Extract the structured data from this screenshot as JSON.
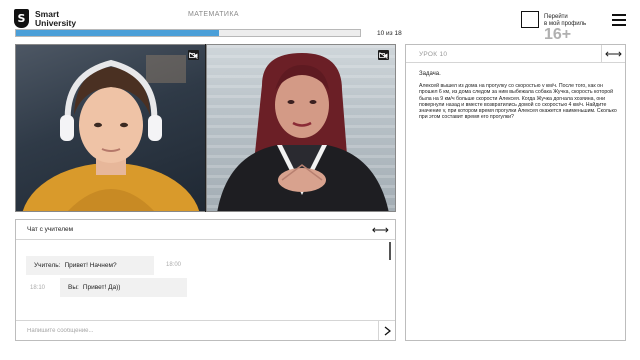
{
  "header": {
    "logo_glyph": "S",
    "logo_line1": "Smart",
    "logo_line2": "University",
    "subject": "МАТЕМАТИКА",
    "progress_fraction": 0.59,
    "progress_text": "10 из 18",
    "profile_line1": "Перейти",
    "profile_line2": "в мой профиль",
    "age_badge": "16+"
  },
  "videos": {
    "student_cam_icon": "camera-off-icon",
    "teacher_cam_icon": "camera-off-icon"
  },
  "chat": {
    "title": "Чат с учителем",
    "expand_glyph": "⟷",
    "messages": [
      {
        "sender": "Учитель:",
        "text": "Привет! Начнем?",
        "time": "18:00"
      },
      {
        "sender": "Вы:",
        "text": "Привет! Да))",
        "time": "18:10"
      }
    ],
    "input_placeholder": "Напишите сообщение..."
  },
  "lesson": {
    "title": "УРОК 10",
    "expand_glyph": "⟷",
    "label": "Задача.",
    "text": "Алексей вышел из дома на прогулку со скоростью v км/ч. После того, как он прошел 6 км, из дома следом за ним выбежала собака Жучка, скорость которой была на 9 км/ч больше скорости Алексея. Когда Жучка догнала хозяина, они повернули назад и вместе возвратились домой со скоростью 4 км/ч. Найдите значение v, при котором время прогулки Алексея окажется наименьшим. Сколько при этом составит время его прогулки?"
  },
  "colors": {
    "accent": "#4b9fd8",
    "text": "#1a1a1a",
    "muted": "#999999",
    "bubble": "#f1f1f1"
  }
}
